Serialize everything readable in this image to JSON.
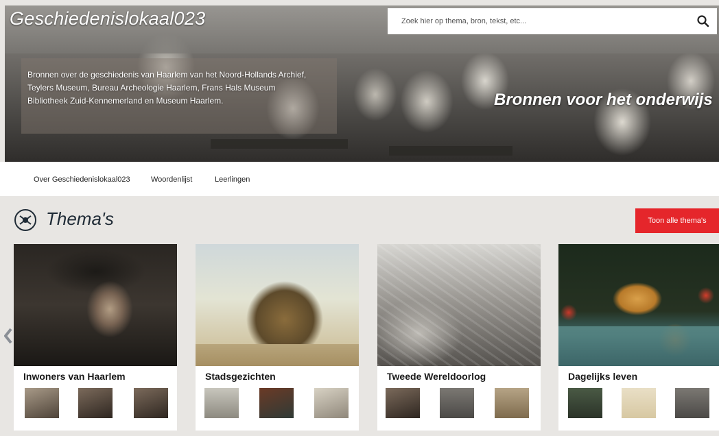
{
  "header": {
    "site_title": "Geschiedenislokaal023",
    "search_placeholder": "Zoek hier op thema, bron, tekst, etc...",
    "intro_line1": "Bronnen over de geschiedenis van Haarlem van het Noord-Hollands Archief,",
    "intro_line2": "Teylers Museum, Bureau Archeologie Haarlem, Frans Hals Museum",
    "intro_line3": "Bibliotheek Zuid-Kennemerland en Museum Haarlem.",
    "tagline": "Bronnen voor het onderwijs"
  },
  "nav": {
    "items": [
      {
        "label": "Over Geschiedenislokaal023"
      },
      {
        "label": "Woordenlijst"
      },
      {
        "label": "Leerlingen"
      }
    ]
  },
  "themes": {
    "title": "Thema's",
    "all_button": "Toon alle thema's",
    "cards": [
      {
        "title": "Inwoners van Haarlem"
      },
      {
        "title": "Stadsgezichten"
      },
      {
        "title": "Tweede Wereldoorlog"
      },
      {
        "title": "Dagelijks leven"
      }
    ]
  },
  "icons": {
    "search": "search-icon",
    "section": "themes-icon",
    "prev": "chevron-left-icon"
  },
  "colors": {
    "accent_red": "#e5262b",
    "title_dark": "#1f2b36"
  }
}
